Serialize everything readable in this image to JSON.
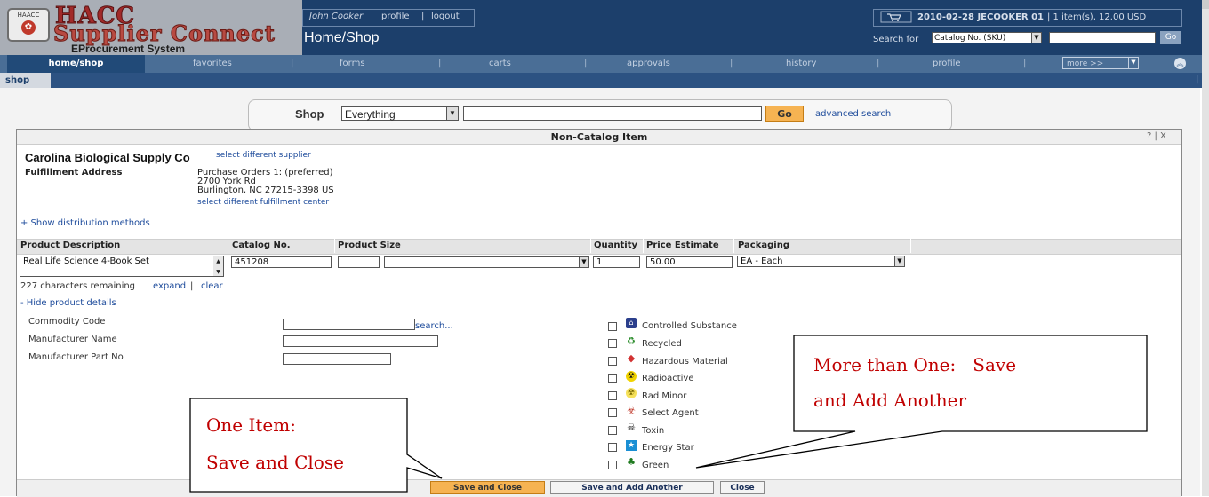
{
  "header": {
    "logo_small": "HAACC",
    "logo_big": "HACC",
    "logo_subtitle": "Supplier Connect",
    "logo_tagline": "EProcurement System",
    "user_name": "John Cooker",
    "profile": "profile",
    "logout": "logout",
    "separator": "|",
    "page_heading": "Home/Shop",
    "cart_summary_bold": "2010-02-28 JECOOKER 01",
    "cart_summary_rest": "| 1 item(s), 12.00 USD",
    "search_for_label": "Search for",
    "search_for_value": "Catalog No. (SKU)",
    "go": "Go"
  },
  "nav": {
    "items": [
      "home/shop",
      "favorites",
      "forms",
      "carts",
      "approvals",
      "history",
      "profile"
    ],
    "more": "more >>",
    "subtab": "shop",
    "help": "| ?"
  },
  "shopbar": {
    "label": "Shop",
    "category": "Everything",
    "query": "",
    "go": "Go",
    "advanced": "advanced search"
  },
  "modal": {
    "title": "Non-Catalog Item",
    "controls": "? | X",
    "supplier": "Carolina Biological Supply Co",
    "supplier_link": "select different supplier",
    "fulfillment_label": "Fulfillment Address",
    "address": [
      "Purchase Orders 1: (preferred)",
      "2700 York Rd",
      "Burlington, NC 27215-3398 US"
    ],
    "fulfillment_link": "select different fulfillment center",
    "show_distribution": "+ Show distribution methods",
    "columns": [
      "Product Description",
      "Catalog No.",
      "Product Size",
      "Quantity",
      "Price Estimate",
      "Packaging"
    ],
    "product_description": "Real Life Science 4-Book Set",
    "catalog_no": "451208",
    "size_value": "",
    "size_unit": "",
    "quantity": "1",
    "price": "50.00",
    "packaging": "EA - Each",
    "chars_remaining": "227 characters remaining",
    "expand": "expand",
    "pipe": "|",
    "clear": "clear",
    "hide_details": "- Hide product details",
    "commodity_label": "Commodity Code",
    "manufacturer_label": "Manufacturer Name",
    "mfr_part_label": "Manufacturer Part No",
    "search_link": "search...",
    "flags": [
      "Controlled Substance",
      "Recycled",
      "Hazardous Material",
      "Radioactive",
      "Rad Minor",
      "Select Agent",
      "Toxin",
      "Energy Star",
      "Green"
    ],
    "buttons": {
      "save_close": "Save and Close",
      "save_another": "Save and Add Another",
      "close": "Close"
    }
  },
  "callouts": {
    "left_line1": "One Item:",
    "left_line2": "Save and Close",
    "right_line1": "More than One:   Save",
    "right_line2": "and Add Another"
  },
  "colors": {
    "header_bg": "#1c3f6b",
    "nav_bg": "#4a6e96",
    "accent_orange": "#f6b352",
    "callout_red": "#c00000",
    "link_blue": "#1d4b9b"
  },
  "icons": [
    "shopping-cart-icon",
    "collapse-icon",
    "controlled-substance-icon",
    "recycle-icon",
    "hazard-icon",
    "radioactive-icon",
    "rad-minor-icon",
    "biohazard-icon",
    "toxin-icon",
    "energy-star-icon",
    "green-tree-icon"
  ]
}
